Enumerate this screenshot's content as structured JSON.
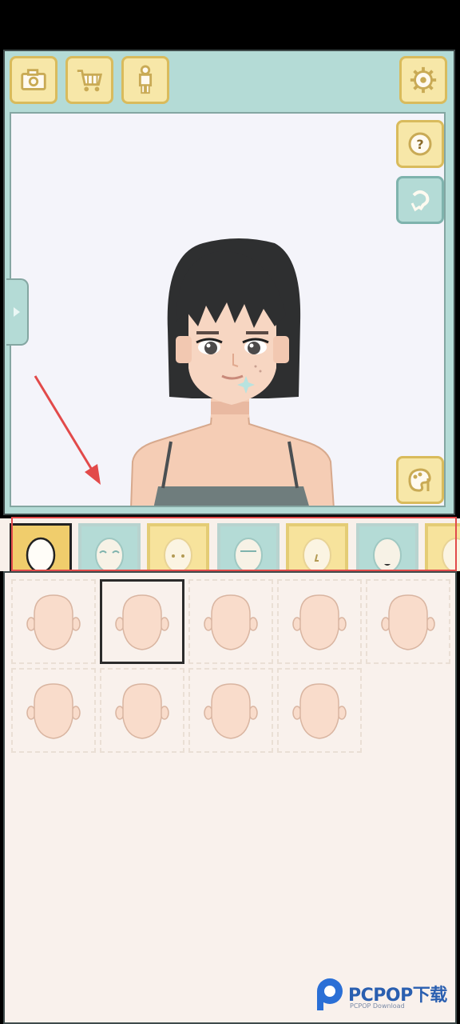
{
  "toolbar": {
    "buttons": [
      {
        "name": "camera-icon"
      },
      {
        "name": "cart-icon"
      },
      {
        "name": "person-icon"
      }
    ],
    "settings": {
      "name": "gear-icon"
    }
  },
  "canvas": {
    "side_buttons": [
      {
        "name": "help-icon",
        "glyph": "?"
      },
      {
        "name": "rotate-icon"
      },
      {
        "name": "palette-icon"
      }
    ]
  },
  "category_tabs": [
    {
      "name": "face-shape",
      "selected": true
    },
    {
      "name": "eyes-closed"
    },
    {
      "name": "eyes-dots"
    },
    {
      "name": "eyebrows-line"
    },
    {
      "name": "nose"
    },
    {
      "name": "mouth"
    },
    {
      "name": "more"
    }
  ],
  "face_options": {
    "count": 9,
    "selected_index": 1
  },
  "watermark": {
    "brand": "PCPOP下载",
    "sub": "PCPOP Download"
  },
  "colors": {
    "teal": "#b4dbd6",
    "yellow": "#f7e7a8",
    "skin": "#f9dccb",
    "highlight": "#e24a4a"
  }
}
